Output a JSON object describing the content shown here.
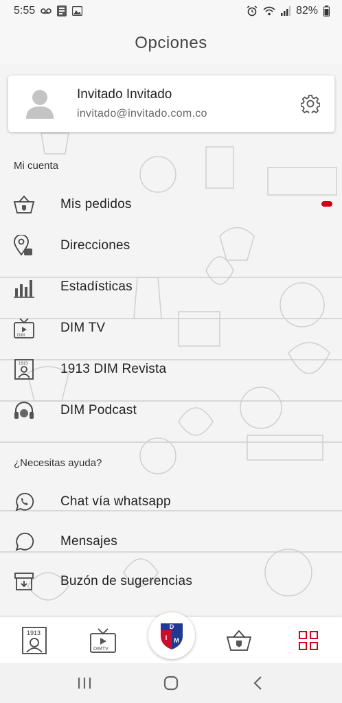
{
  "status_bar": {
    "time": "5:55",
    "battery": "82%"
  },
  "header": {
    "title": "Opciones"
  },
  "profile": {
    "name": "Invitado Invitado",
    "email": "invitado@invitado.com.co"
  },
  "account_section": {
    "title": "Mi cuenta",
    "items": [
      {
        "label": "Mis pedidos",
        "icon": "basket-icon"
      },
      {
        "label": "Direcciones",
        "icon": "location-icon"
      },
      {
        "label": "Estadísticas",
        "icon": "stats-icon"
      },
      {
        "label": "DIM TV",
        "icon": "tv-icon"
      },
      {
        "label": "1913 DIM Revista",
        "icon": "magazine-icon"
      },
      {
        "label": "DIM Podcast",
        "icon": "headphones-icon"
      }
    ]
  },
  "help_section": {
    "title": "¿Necesitas ayuda?",
    "items": [
      {
        "label": "Chat vía whatsapp",
        "icon": "whatsapp-icon"
      },
      {
        "label": "Mensajes",
        "icon": "chat-bubble-icon"
      },
      {
        "label": "Buzón de sugerencias",
        "icon": "inbox-icon"
      }
    ]
  },
  "bottom_nav": {
    "magazine_label": "1913",
    "tv_label": "DIMTV",
    "logo_text": "DIM"
  },
  "colors": {
    "accent": "#d0021b",
    "team_blue": "#1f3a93",
    "team_red": "#c8102e"
  }
}
